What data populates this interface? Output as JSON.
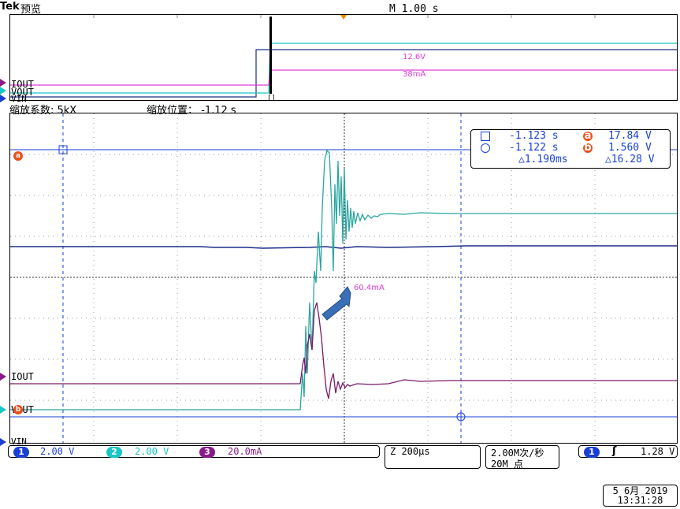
{
  "header": {
    "brand": "Tek",
    "mode": "预览",
    "timebase": "M 1.00 s"
  },
  "overview": {
    "labels": [
      "IOUT",
      "VOUT",
      "VIN"
    ],
    "annotation_voltage": "12.6V",
    "annotation_current": "38mA"
  },
  "zoom": {
    "factor": "缩放系数: 5kX",
    "position": "缩放位置： -1.12 s"
  },
  "main": {
    "labels": [
      "IOUT",
      "VOUT",
      "VIN"
    ],
    "peak_annotation": "60.4mA"
  },
  "cursors": {
    "row1_icon": "square-cursor-icon",
    "row1_time": "-1.123 s",
    "row1_marker": "a",
    "row1_value": "17.84 V",
    "row2_icon": "circle-cursor-icon",
    "row2_time": "-1.122 s",
    "row2_marker": "b",
    "row2_value": "1.560 V",
    "delta_time": "△1.190ms",
    "delta_value": "△16.28 V"
  },
  "channels": [
    {
      "num": "1",
      "scale": "2.00 V",
      "color": "#1a3fd6"
    },
    {
      "num": "2",
      "scale": "2.00 V",
      "color": "#19c6c6"
    },
    {
      "num": "3",
      "scale": "20.0mA",
      "color": "#8a1a8a"
    }
  ],
  "horizontal": {
    "scale": "Z 200µs",
    "sample_rate": "2.00M次/秒",
    "record_length": "20M 点"
  },
  "trigger": {
    "channel": "1",
    "slope_symbol": "ʃ",
    "level": "1.28 V"
  },
  "datetime": {
    "date": "5 6月 2019",
    "time": "13:31:28"
  },
  "colors": {
    "ch1": "#1a3fd6",
    "ch2": "#19c6c6",
    "ch3": "#8a1a8a",
    "ch2_trace": "#2aa6a0",
    "ch3_trace": "#7a1a6a",
    "orange": "#e8501c",
    "arrow": "#3a6fb5"
  }
}
